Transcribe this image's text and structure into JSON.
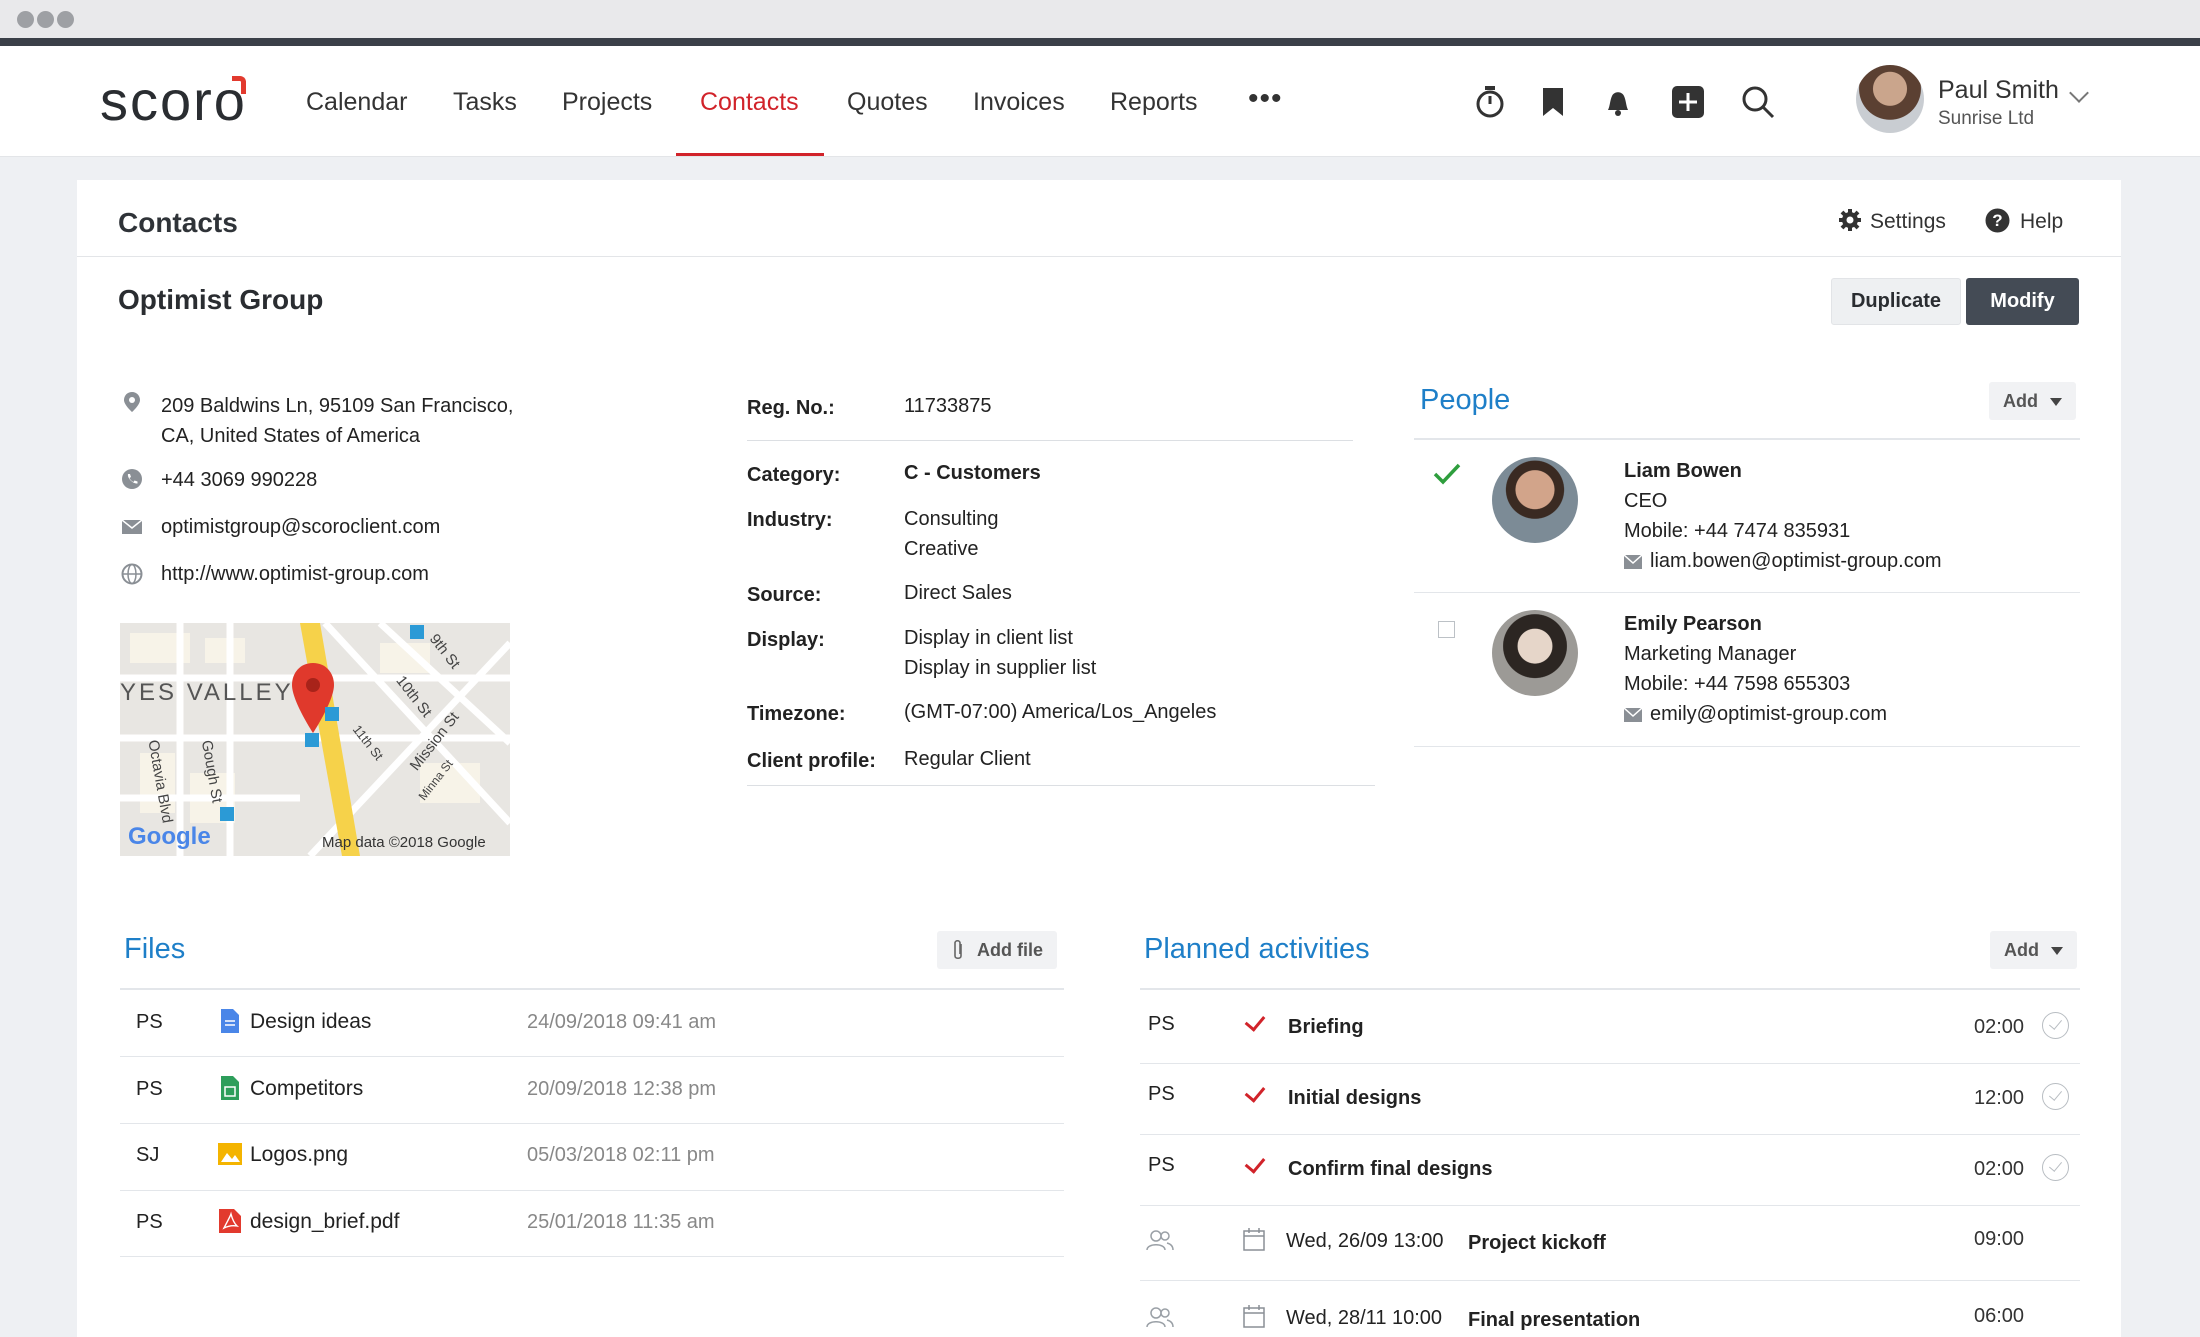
{
  "app": {
    "logo": "scoro"
  },
  "nav": {
    "items": [
      "Calendar",
      "Tasks",
      "Projects",
      "Contacts",
      "Quotes",
      "Invoices",
      "Reports"
    ],
    "more": "•••",
    "active": "Contacts",
    "icons": [
      "timer-icon",
      "bookmark-icon",
      "bell-icon",
      "plus-square-icon",
      "search-icon"
    ]
  },
  "user": {
    "name": "Paul Smith",
    "company": "Sunrise Ltd"
  },
  "header": {
    "title": "Contacts",
    "settings": "Settings",
    "help": "Help"
  },
  "company": {
    "name": "Optimist Group",
    "duplicate": "Duplicate",
    "modify": "Modify",
    "address_line1": "209 Baldwins Ln, 95109 San Francisco,",
    "address_line2": "CA, United States of America",
    "phone": "+44 3069 990228",
    "email": "optimistgroup@scoroclient.com",
    "website": "http://www.optimist-group.com",
    "map": {
      "attribution": "Map data ©2018 Google",
      "brand": "Google",
      "labels": [
        "YES VALLEY",
        "9th St",
        "10th St",
        "11th St",
        "Mission St",
        "Minna St",
        "Gough St",
        "Octavia Blvd"
      ]
    }
  },
  "details": {
    "reg_label": "Reg. No.:",
    "reg_value": "11733875",
    "category_label": "Category:",
    "category_value": "C - Customers",
    "industry_label": "Industry:",
    "industry_value1": "Consulting",
    "industry_value2": "Creative",
    "source_label": "Source:",
    "source_value": "Direct Sales",
    "display_label": "Display:",
    "display_value1": "Display in client list",
    "display_value2": "Display in supplier list",
    "timezone_label": "Timezone:",
    "timezone_value": "(GMT-07:00) America/Los_Angeles",
    "profile_label": "Client profile:",
    "profile_value": "Regular Client"
  },
  "people": {
    "title": "People",
    "add": "Add",
    "list": [
      {
        "name": "Liam Bowen",
        "role": "CEO",
        "mobile": "Mobile: +44 7474 835931",
        "email": "liam.bowen@optimist-group.com",
        "primary": true
      },
      {
        "name": "Emily Pearson",
        "role": "Marketing Manager",
        "mobile": "Mobile: +44 7598 655303",
        "email": "emily@optimist-group.com",
        "primary": false
      }
    ]
  },
  "files": {
    "title": "Files",
    "add": "Add file",
    "rows": [
      {
        "initials": "PS",
        "name": "Design ideas",
        "date": "24/09/2018 09:41 am",
        "type": "doc",
        "color": "#4a86e8"
      },
      {
        "initials": "PS",
        "name": "Competitors",
        "date": "20/09/2018 12:38 pm",
        "type": "sheet",
        "color": "#2e9e5b"
      },
      {
        "initials": "SJ",
        "name": "Logos.png",
        "date": "05/03/2018 02:11 pm",
        "type": "image",
        "color": "#f4b400"
      },
      {
        "initials": "PS",
        "name": "design_brief.pdf",
        "date": "25/01/2018 11:35 am",
        "type": "pdf",
        "color": "#e23a2e"
      }
    ]
  },
  "activities": {
    "title": "Planned activities",
    "add": "Add",
    "rows": [
      {
        "initials": "PS",
        "name": "Briefing",
        "time": "02:00"
      },
      {
        "initials": "PS",
        "name": "Initial designs",
        "time": "12:00"
      },
      {
        "initials": "PS",
        "name": "Confirm final designs",
        "time": "02:00"
      },
      {
        "date": "Wed, 26/09 13:00",
        "name": "Project kickoff",
        "time": "09:00"
      },
      {
        "date": "Wed, 28/11 10:00",
        "name": "Final presentation",
        "time": "06:00"
      }
    ]
  },
  "colors": {
    "accent": "#d1232a",
    "link": "#1e7fc8",
    "dark_button": "#444b55"
  }
}
